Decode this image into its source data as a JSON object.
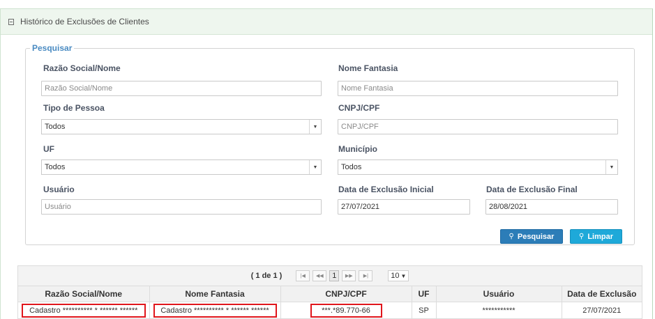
{
  "panel": {
    "title": "Histórico de Exclusões de Clientes"
  },
  "search": {
    "legend": "Pesquisar",
    "razao_label": "Razão Social/Nome",
    "razao_placeholder": "Razão Social/Nome",
    "fantasia_label": "Nome Fantasia",
    "fantasia_placeholder": "Nome Fantasia",
    "tipo_label": "Tipo de Pessoa",
    "tipo_value": "Todos",
    "cnpj_label": "CNPJ/CPF",
    "cnpj_placeholder": "CNPJ/CPF",
    "uf_label": "UF",
    "uf_value": "Todos",
    "municipio_label": "Município",
    "municipio_value": "Todos",
    "usuario_label": "Usuário",
    "usuario_placeholder": "Usuário",
    "data_inicial_label": "Data de Exclusão Inicial",
    "data_inicial_value": "27/07/2021",
    "data_final_label": "Data de Exclusão Final",
    "data_final_value": "28/08/2021",
    "pesquisar_button": "Pesquisar",
    "limpar_button": "Limpar"
  },
  "paginator": {
    "count": "( 1 de 1 )",
    "first_icon": "first-page-icon",
    "prev_icon": "prev-page-icon",
    "current_page": "1",
    "next_icon": "next-page-icon",
    "last_icon": "last-page-icon",
    "rows_per_page": "10"
  },
  "grid": {
    "columns": [
      "Razão Social/Nome",
      "Nome Fantasia",
      "CNPJ/CPF",
      "UF",
      "Usuário",
      "Data de Exclusão"
    ],
    "rows": [
      {
        "razao": "Cadastro ********** * ****** ******",
        "fantasia": "Cadastro ********** * ****** ******",
        "cnpj": "***.*89.770-66",
        "uf": "SP",
        "usuario": "***********",
        "data": "27/07/2021"
      }
    ]
  },
  "colors": {
    "accent": "#2c7db8",
    "clear": "#1ea9d9",
    "highlight": "#e0161c",
    "header_bg": "#eef6ee"
  }
}
